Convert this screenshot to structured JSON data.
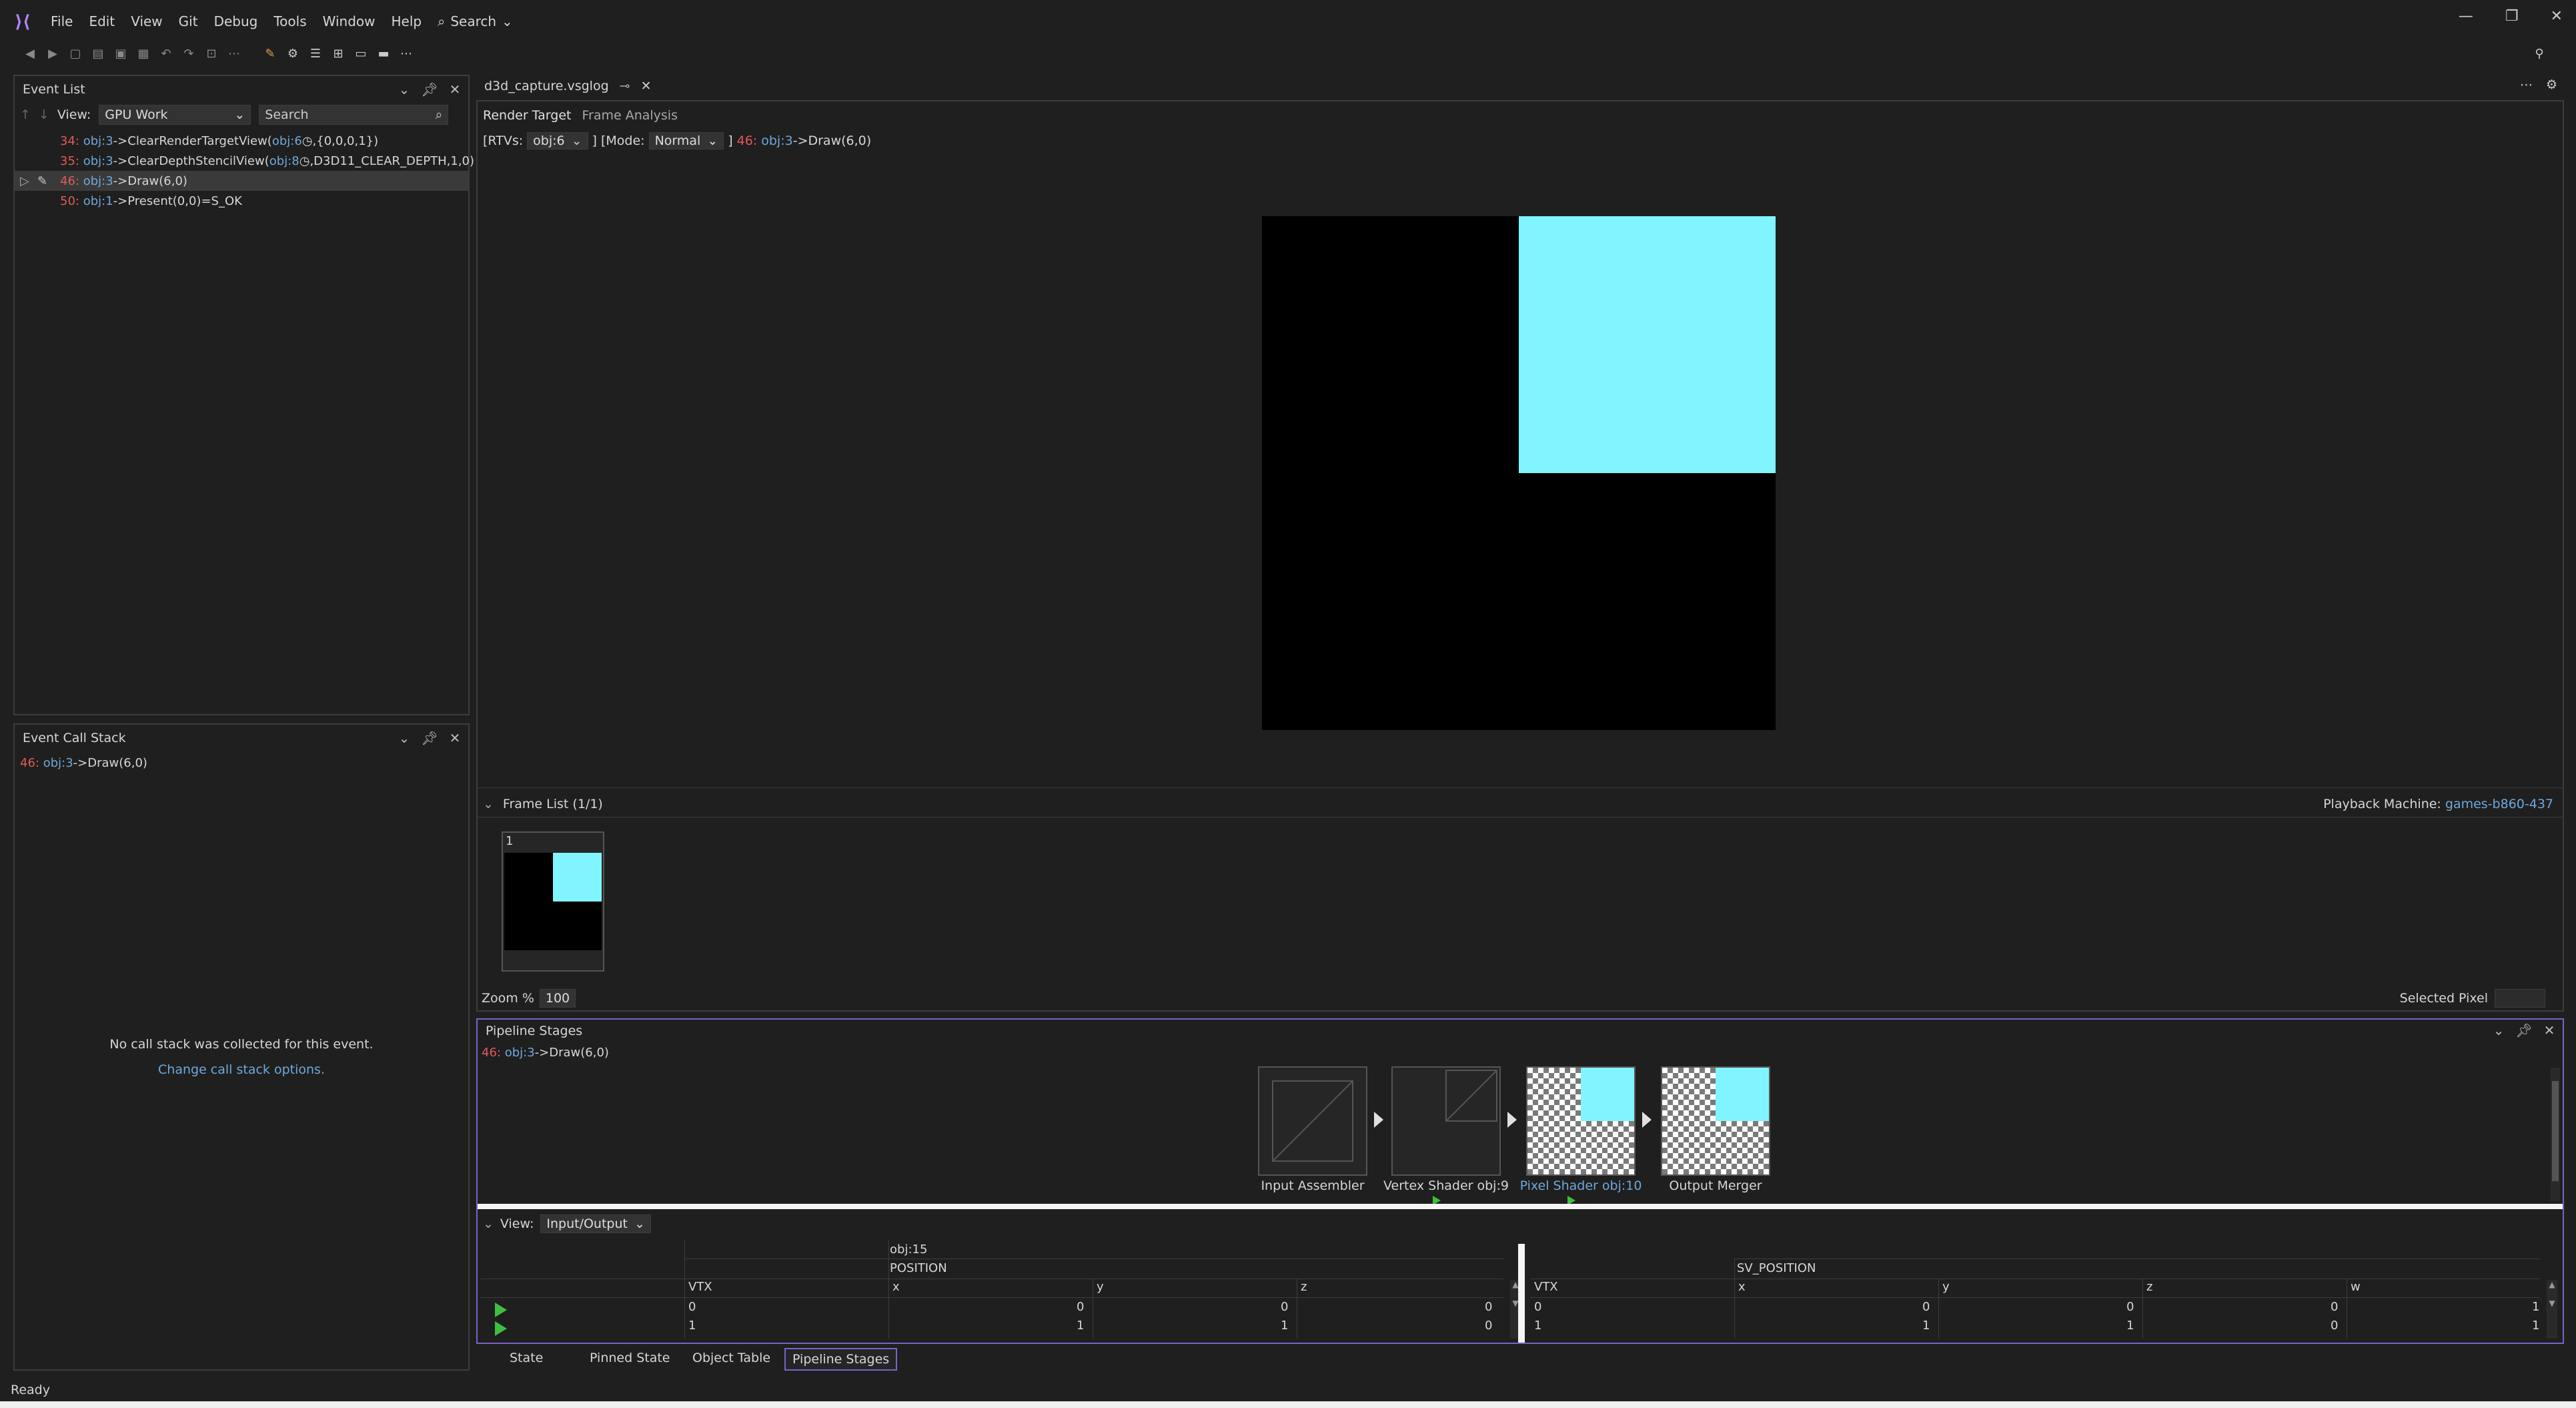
{
  "menubar": {
    "items": [
      "File",
      "Edit",
      "View",
      "Git",
      "Debug",
      "Tools",
      "Window",
      "Help"
    ],
    "search_label": "Search"
  },
  "event_list": {
    "title": "Event List",
    "view_label": "View:",
    "view_value": "GPU Work",
    "search_placeholder": "Search",
    "rows": [
      {
        "num": "34:",
        "obj": "obj:3",
        "call": "->ClearRenderTargetView(",
        "arg_obj": "obj:6",
        "rest": ",{0,0,0,1})"
      },
      {
        "num": "35:",
        "obj": "obj:3",
        "call": "->ClearDepthStencilView(",
        "arg_obj": "obj:8",
        "rest": ",D3D11_CLEAR_DEPTH,1,0)"
      },
      {
        "num": "46:",
        "obj": "obj:3",
        "call": "->Draw(6,0)",
        "arg_obj": "",
        "rest": ""
      },
      {
        "num": "50:",
        "obj": "obj:1",
        "call": "->Present(0,0)=S_OK",
        "arg_obj": "",
        "rest": ""
      }
    ]
  },
  "call_stack": {
    "title": "Event Call Stack",
    "entry_num": "46:",
    "entry_obj": "obj:3",
    "entry_call": "->Draw(6,0)",
    "empty_msg": "No call stack was collected for this event.",
    "change_link": "Change call stack options."
  },
  "document": {
    "tab_title": "d3d_capture.vsglog",
    "subtabs": [
      "Render Target",
      "Frame Analysis"
    ],
    "rtv_prefix": "[RTVs:",
    "rtv_value": "obj:6",
    "mode_prefix": "] [Mode:",
    "mode_value": "Normal",
    "mode_suffix": "]",
    "event_num": "46:",
    "event_obj": "obj:3",
    "event_call": "->Draw(6,0)",
    "render_colors": {
      "background": "#000000",
      "quad": "#80f4ff"
    }
  },
  "frame_list": {
    "title": "Frame List (1/1)",
    "playback_label": "Playback Machine:",
    "playback_value": "games-b860-437",
    "frame_number": "1",
    "zoom_label": "Zoom %",
    "zoom_value": "100",
    "selected_pixel_label": "Selected Pixel"
  },
  "pipeline": {
    "title": "Pipeline Stages",
    "event_num": "46:",
    "event_obj": "obj:3",
    "event_call": "->Draw(6,0)",
    "stages": [
      {
        "label": "Input Assembler"
      },
      {
        "label": "Vertex Shader obj:9"
      },
      {
        "label": "Pixel Shader obj:10"
      },
      {
        "label": "Output Merger"
      }
    ],
    "view_label": "View:",
    "view_value": "Input/Output",
    "input_obj": "obj:15",
    "input_semantic": "POSITION",
    "output_semantic": "SV_POSITION",
    "input_headers": [
      "VTX",
      "x",
      "y",
      "z"
    ],
    "output_headers": [
      "VTX",
      "x",
      "y",
      "z",
      "w"
    ],
    "input_rows": [
      [
        "0",
        "0",
        "0",
        "0"
      ],
      [
        "1",
        "1",
        "1",
        "0"
      ]
    ],
    "output_rows": [
      [
        "0",
        "0",
        "0",
        "0",
        "1"
      ],
      [
        "1",
        "1",
        "1",
        "0",
        "1"
      ]
    ]
  },
  "bottom_tabs": [
    "State",
    "Pinned State",
    "Object Table",
    "Pipeline Stages"
  ],
  "status": "Ready"
}
